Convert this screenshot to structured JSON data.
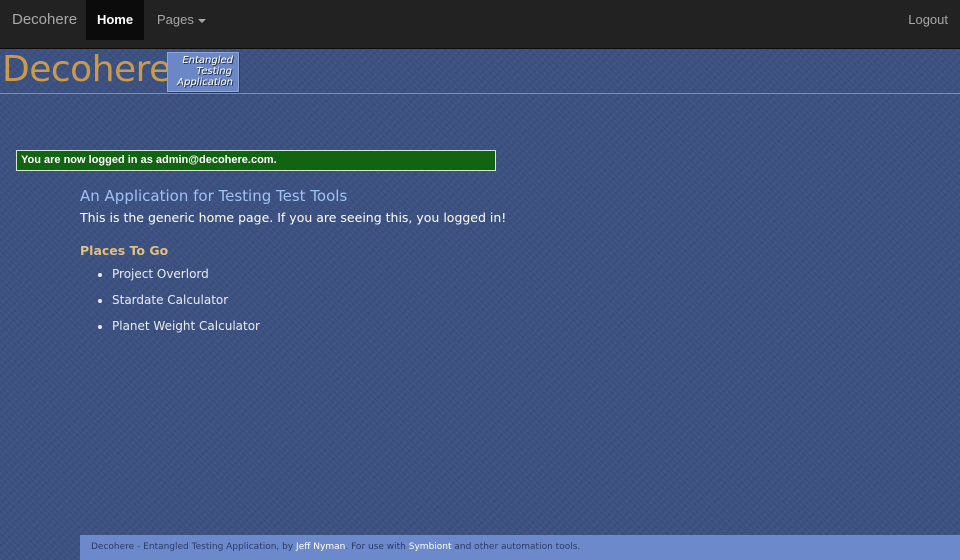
{
  "navbar": {
    "brand": "Decohere",
    "home_label": "Home",
    "pages_label": "Pages",
    "logout_label": "Logout"
  },
  "header": {
    "logo_text": "Decohere",
    "badge_line1": "Entangled",
    "badge_line2": "Testing",
    "badge_line3": "Application"
  },
  "flash": {
    "message": "You are now logged in as admin@decohere.com."
  },
  "main": {
    "title": "An Application for Testing Test Tools",
    "text": "This is the generic home page. If you are seeing this, you logged in!",
    "places_heading": "Places To Go",
    "places": [
      {
        "label": "Project Overlord"
      },
      {
        "label": "Stardate Calculator"
      },
      {
        "label": "Planet Weight Calculator"
      }
    ]
  },
  "footer": {
    "prefix": "Decohere - Entangled Testing Application, by ",
    "author": "Jeff Nyman",
    "middle": ". For use with ",
    "tool": "Symbiont",
    "suffix": " and other automation tools."
  },
  "colors": {
    "background": "#3b5080",
    "navbar": "#222222",
    "flash_success": "#126312",
    "logo": "#c99a4d",
    "heading": "#9fc2f5",
    "subheading": "#e2bf7c",
    "footer": "#6c89cc"
  },
  "icons": {
    "pages_dropdown": "caret-down-icon"
  }
}
